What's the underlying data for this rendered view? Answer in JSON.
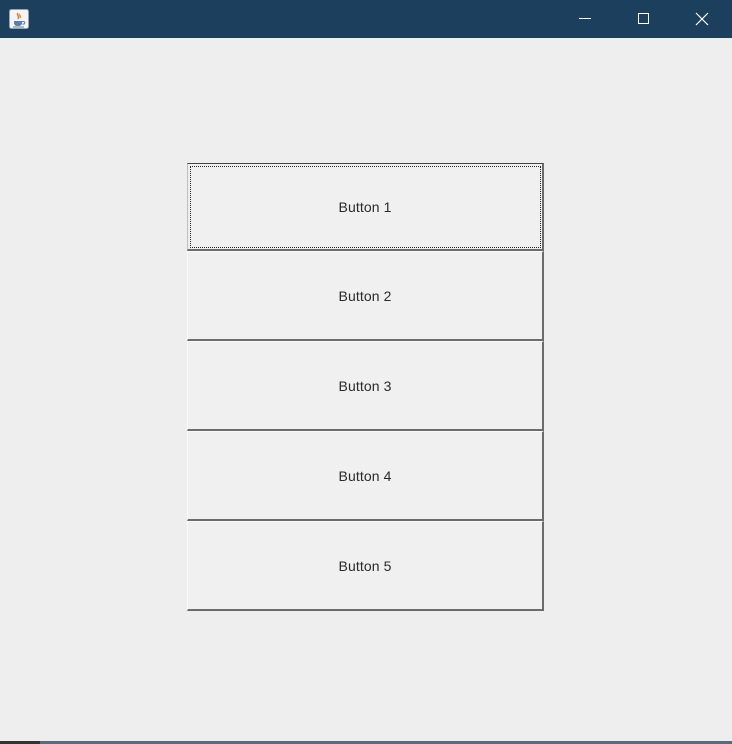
{
  "window": {
    "title": "",
    "titlebar_color": "#1c3f5e",
    "background_color": "#eeeeee",
    "icons": {
      "app": "java-coffee-icon",
      "minimize": "minimize-icon",
      "maximize": "maximize-icon",
      "close": "close-icon"
    }
  },
  "buttons": [
    {
      "label": "Button 1",
      "focused": true
    },
    {
      "label": "Button 2",
      "focused": false
    },
    {
      "label": "Button 3",
      "focused": false
    },
    {
      "label": "Button 4",
      "focused": false
    },
    {
      "label": "Button 5",
      "focused": false
    }
  ]
}
